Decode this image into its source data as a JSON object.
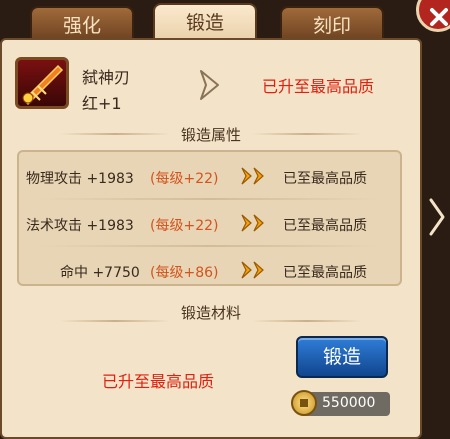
{
  "tabs": [
    {
      "label": "强化",
      "active": false
    },
    {
      "label": "锻造",
      "active": true
    },
    {
      "label": "刻印",
      "active": false
    }
  ],
  "item": {
    "name": "弑神刃",
    "level": "红+1",
    "icon": "blade-icon",
    "status": "已升至最高品质"
  },
  "attributes_title": "锻造属性",
  "attributes": [
    {
      "label": "物理攻击 +1983",
      "bonus": "(每级+22)",
      "result": "已至最高品质"
    },
    {
      "label": "法术攻击 +1983",
      "bonus": "(每级+22)",
      "result": "已至最高品质"
    },
    {
      "label": "命中 +7750",
      "bonus": "(每级+86)",
      "result": "已至最高品质"
    }
  ],
  "materials_title": "锻造材料",
  "materials_status": "已升至最高品质",
  "forge_button": "锻造",
  "gold": "550000",
  "colors": {
    "accent_red": "#e02010",
    "bonus_orange": "#d2541e",
    "button_blue": "#2f7ed8"
  }
}
